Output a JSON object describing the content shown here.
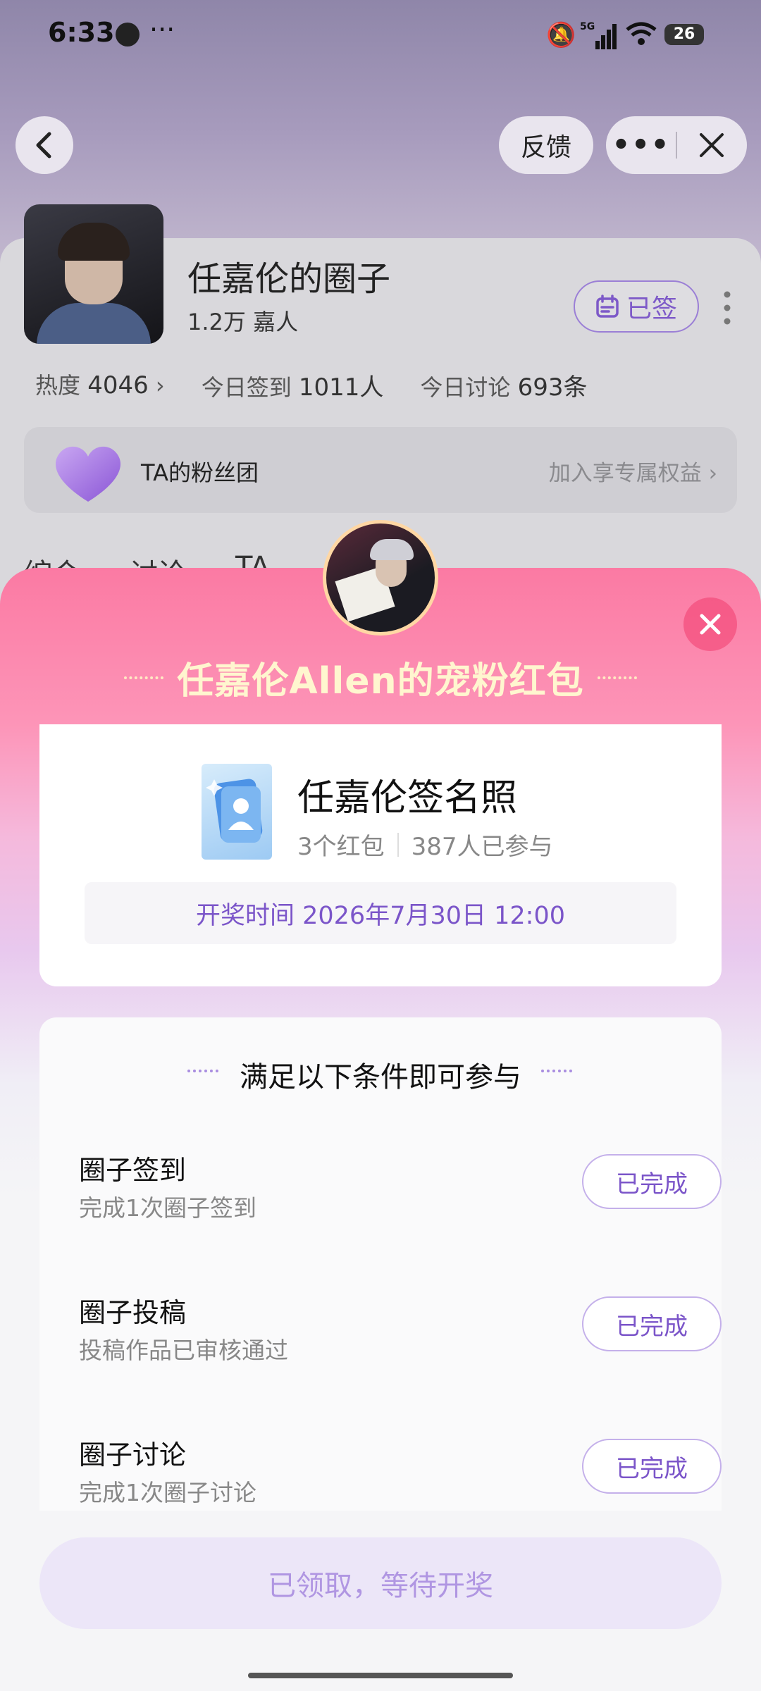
{
  "status_bar": {
    "time": "6:33",
    "dots": "···",
    "battery": "26",
    "network": "5G"
  },
  "top_bar": {
    "feedback_label": "反馈"
  },
  "circle": {
    "title": "任嘉伦的圈子",
    "fans": "1.2万 嘉人",
    "signed_label": "已签",
    "stats": {
      "heat_label": "热度",
      "heat_value": "4046",
      "checkin_label": "今日签到",
      "checkin_value": "1011人",
      "discuss_label": "今日讨论",
      "discuss_value": "693条"
    },
    "fanclub": {
      "title": "TA的粉丝团",
      "action": "加入享专属权益"
    },
    "tabs": [
      "综合",
      "讨论",
      "TA"
    ]
  },
  "modal": {
    "title": "任嘉伦Allen的宠粉红包",
    "prize": {
      "name": "任嘉伦签名照",
      "count": "3个红包",
      "participants": "387人已参与",
      "draw_time": "开奖时间 2026年7月30日 12:00"
    },
    "conditions_header": "满足以下条件即可参与",
    "conditions": [
      {
        "title": "圈子签到",
        "desc": "完成1次圈子签到",
        "status": "已完成"
      },
      {
        "title": "圈子投稿",
        "desc": "投稿作品已审核通过",
        "status": "已完成"
      },
      {
        "title": "圈子讨论",
        "desc": "完成1次圈子讨论",
        "status": "已完成"
      }
    ],
    "bottom_button": "已领取，等待开奖"
  },
  "colors": {
    "accent": "#7b55c9",
    "modal_pink": "#fb7aa3",
    "title_gold": "#fff6cf"
  }
}
